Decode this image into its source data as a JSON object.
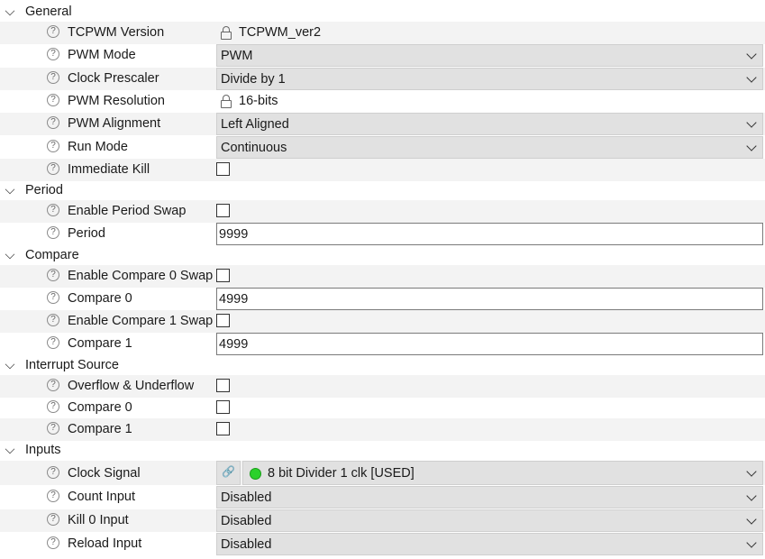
{
  "general": {
    "title": "General",
    "tcpwm_version": {
      "label": "TCPWM Version",
      "value": "TCPWM_ver2"
    },
    "pwm_mode": {
      "label": "PWM Mode",
      "value": "PWM"
    },
    "clock_prescaler": {
      "label": "Clock Prescaler",
      "value": "Divide by 1"
    },
    "pwm_resolution": {
      "label": "PWM Resolution",
      "value": "16-bits"
    },
    "pwm_alignment": {
      "label": "PWM Alignment",
      "value": "Left Aligned"
    },
    "run_mode": {
      "label": "Run Mode",
      "value": "Continuous"
    },
    "immediate_kill": {
      "label": "Immediate Kill",
      "checked": false
    }
  },
  "period": {
    "title": "Period",
    "enable_period_swap": {
      "label": "Enable Period Swap",
      "checked": false
    },
    "period": {
      "label": "Period",
      "value": "9999"
    }
  },
  "compare": {
    "title": "Compare",
    "enable_compare0_swap": {
      "label": "Enable Compare 0 Swap",
      "checked": false
    },
    "compare0": {
      "label": "Compare 0",
      "value": "4999"
    },
    "enable_compare1_swap": {
      "label": "Enable Compare 1 Swap",
      "checked": false
    },
    "compare1": {
      "label": "Compare 1",
      "value": "4999"
    }
  },
  "interrupt_source": {
    "title": "Interrupt Source",
    "overflow_underflow": {
      "label": "Overflow & Underflow",
      "checked": false
    },
    "compare0": {
      "label": "Compare 0",
      "checked": false
    },
    "compare1": {
      "label": "Compare 1",
      "checked": false
    }
  },
  "inputs": {
    "title": "Inputs",
    "clock_signal": {
      "label": "Clock Signal",
      "value": "8 bit Divider 1 clk [USED]",
      "status_color": "#2bd12b"
    },
    "count_input": {
      "label": "Count Input",
      "value": "Disabled"
    },
    "kill0_input": {
      "label": "Kill 0 Input",
      "value": "Disabled"
    },
    "reload_input": {
      "label": "Reload Input",
      "value": "Disabled"
    }
  },
  "icons": {
    "help": "?",
    "link": "🔗"
  }
}
